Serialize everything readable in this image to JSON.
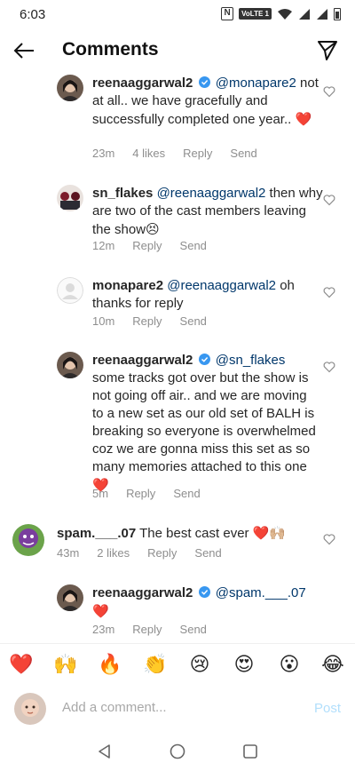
{
  "status_bar": {
    "time": "6:03",
    "network_badge": "VoLTE 1"
  },
  "header": {
    "title": "Comments"
  },
  "comments": [
    {
      "username": "reenaaggarwal2",
      "verified": true,
      "mention": "@monapare2",
      "text": "not at all.. we have gracefully and successfully completed one year..",
      "emoji": "❤️",
      "time": "23m",
      "likes": "4 likes",
      "reply": "Reply",
      "send": "Send"
    },
    {
      "username": "sn_flakes",
      "mention": "@reenaaggarwal2",
      "text": "then why are two of the cast members leaving the show",
      "emoji": "😣",
      "time": "12m",
      "reply": "Reply",
      "send": "Send"
    },
    {
      "username": "monapare2",
      "mention": "@reenaaggarwal2",
      "text": "oh thanks for reply",
      "time": "10m",
      "reply": "Reply",
      "send": "Send"
    },
    {
      "username": "reenaaggarwal2",
      "verified": true,
      "mention": "@sn_flakes",
      "text": "some tracks got over but the show is not going off air.. and we are moving to a new set as our old set of BALH is breaking so everyone is overwhelmed coz we are gonna miss this set as so many memories attached to this one",
      "emoji": "❤️",
      "time": "5m",
      "reply": "Reply",
      "send": "Send"
    },
    {
      "username": "spam.___.07",
      "text": "The best cast ever",
      "emoji": "❤️🙌🏼",
      "time": "43m",
      "likes": "2 likes",
      "reply": "Reply",
      "send": "Send"
    },
    {
      "username": "reenaaggarwal2",
      "verified": true,
      "mention": "@spam.___.07",
      "text": "",
      "emoji": "❤️",
      "time": "23m",
      "reply": "Reply",
      "send": "Send"
    }
  ],
  "reactions": [
    "❤️",
    "🙌",
    "🔥",
    "👏",
    "😢",
    "😍",
    "😮",
    "😂"
  ],
  "composer": {
    "placeholder": "Add a comment...",
    "post_label": "Post"
  },
  "colors": {
    "accent": "#0095f6",
    "post_disabled": "#b2dffc",
    "verified": "#3897f0",
    "heart": "#ed4956"
  }
}
